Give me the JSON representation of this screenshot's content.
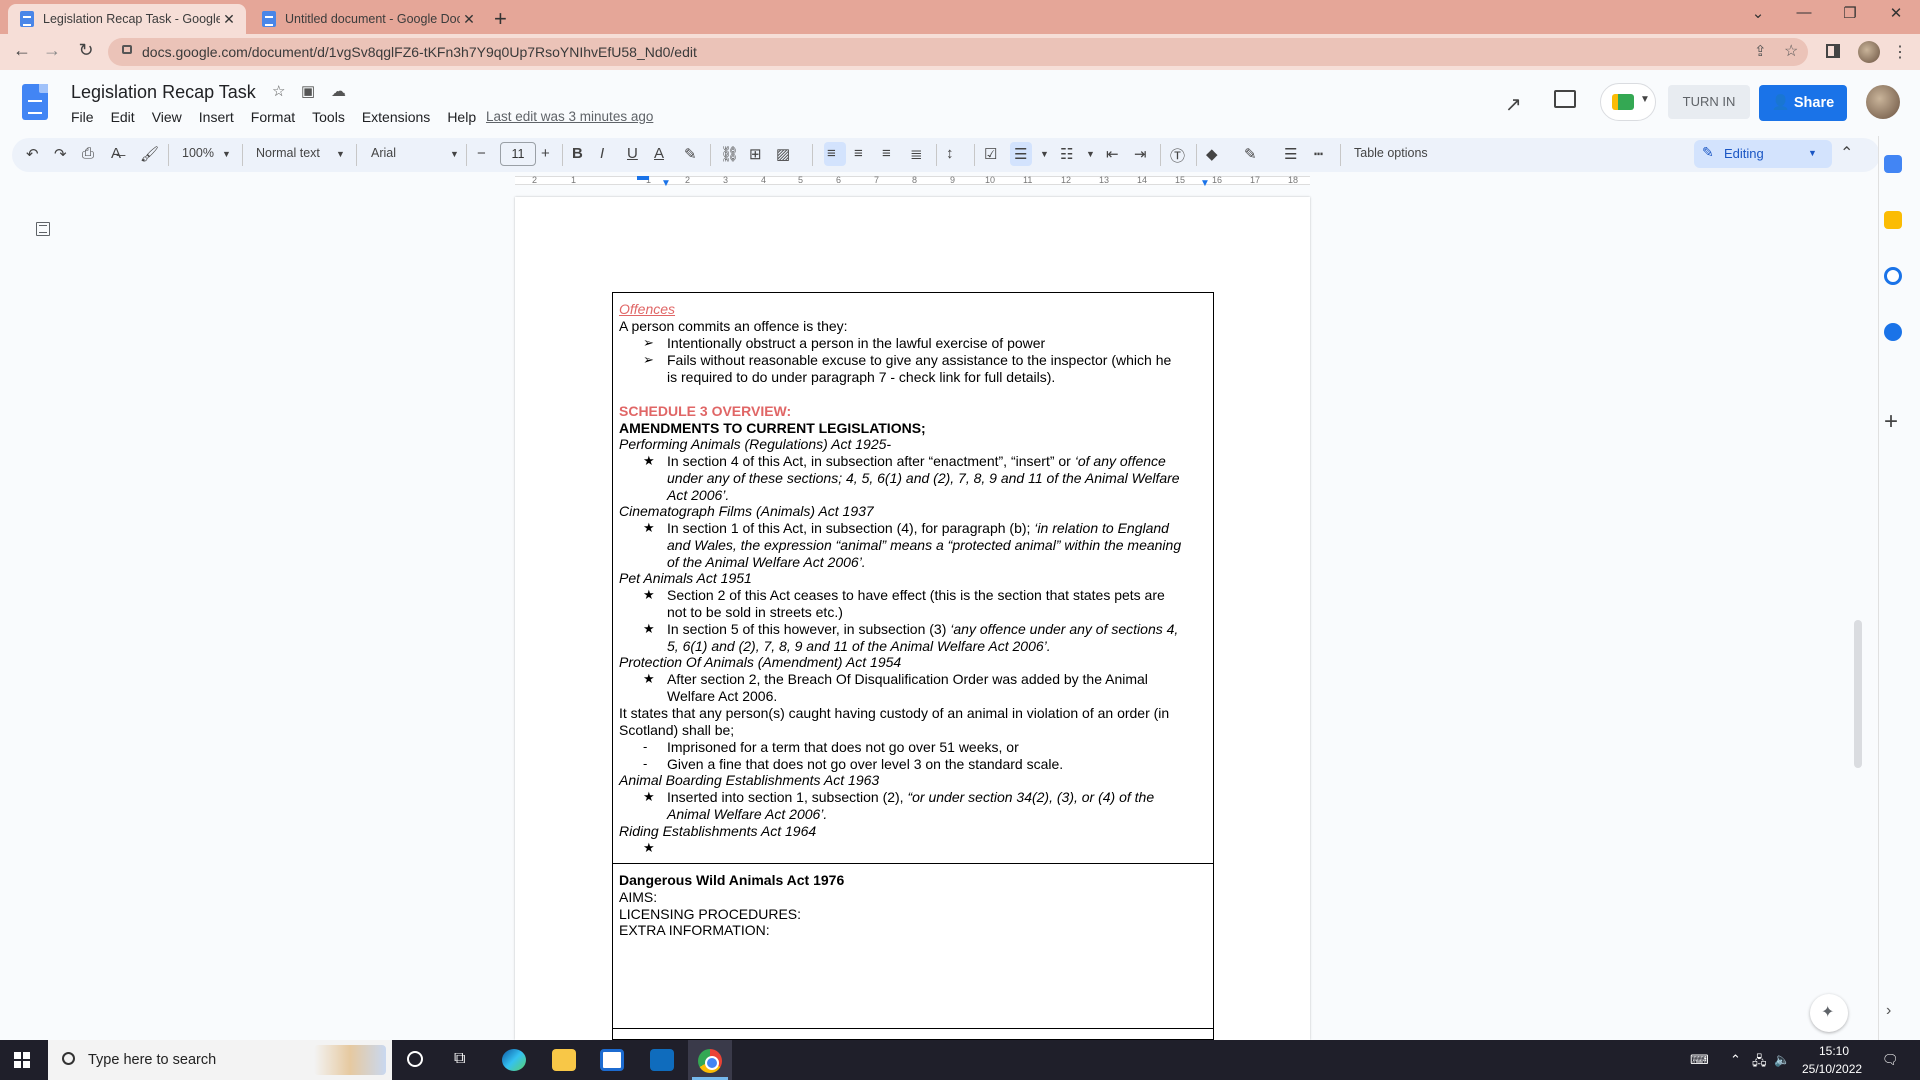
{
  "browser": {
    "tabs": [
      {
        "title": "Legislation Recap Task - Google D",
        "active": true
      },
      {
        "title": "Untitled document - Google Doc",
        "active": false
      }
    ],
    "url": "docs.google.com/document/d/1vgSv8qglFZ6-tKFn3h7Y9q0Up7RsoYNIhvEfU58_Nd0/edit"
  },
  "docs": {
    "title": "Legislation Recap Task",
    "menu": [
      "File",
      "Edit",
      "View",
      "Insert",
      "Format",
      "Tools",
      "Extensions",
      "Help"
    ],
    "last_edit": "Last edit was 3 minutes ago",
    "turn_in": "TURN IN",
    "share": "Share"
  },
  "toolbar": {
    "zoom": "100%",
    "style": "Normal text",
    "font": "Arial",
    "font_size": "11",
    "table_options": "Table options",
    "mode": "Editing"
  },
  "ruler": [
    "2",
    "1",
    "1",
    "2",
    "3",
    "4",
    "5",
    "6",
    "7",
    "8",
    "9",
    "10",
    "11",
    "12",
    "13",
    "14",
    "15",
    "16",
    "17",
    "18"
  ],
  "document": {
    "offences_heading": "Offences",
    "offences_intro": "A person commits an offence is they:",
    "offences_bullets": [
      "Intentionally obstruct a person in the lawful exercise of power",
      "Fails without reasonable excuse to give any assistance to the inspector (which he",
      "is required to do under paragraph 7 - check link for full details)."
    ],
    "schedule_heading": "SCHEDULE 3 OVERVIEW:",
    "amendments_heading": "AMENDMENTS TO CURRENT LEGISLATIONS;",
    "act1": "Performing Animals (Regulations) Act 1925-",
    "act1_b1_plain": "In section 4 of this Act, in subsection after “enactment”, “insert” or ",
    "act1_b1_it": "‘of any offence",
    "act1_b1_l2": "under any of these sections; 4, 5, 6(1) and (2), 7, 8, 9 and 11 of the Animal Welfare",
    "act1_b1_l3": "Act 2006’.",
    "act2": "Cinematograph Films (Animals) Act 1937",
    "act2_b1_plain": "In section 1 of this Act, in subsection (4), for paragraph (b); ",
    "act2_b1_it": "‘in relation to England",
    "act2_b1_l2": "and Wales, the expression “animal” means a “protected animal” within the meaning",
    "act2_b1_l3": "of the Animal Welfare Act 2006’.",
    "act3": "Pet Animals Act 1951",
    "act3_b1_l1": "Section 2 of this Act ceases to have effect (this is the section that states pets are",
    "act3_b1_l2": "not to be sold in streets etc.)",
    "act3_b2_plain": "In section 5 of this however, in subsection (3) ",
    "act3_b2_it": "‘any offence under any of sections 4,",
    "act3_b2_l2": "5, 6(1) and (2), 7, 8, 9 and 11 of the Animal Welfare Act 2006’.",
    "act4": "Protection Of Animals (Amendment) Act 1954",
    "act4_b1_l1": "After section 2, the Breach Of Disqualification Order was added by the Animal",
    "act4_b1_l2": "Welfare Act 2006.",
    "act4_p1": "It states that any person(s) caught having custody of an animal in violation of an order (in",
    "act4_p2": "Scotland) shall be;",
    "act4_d1": "Imprisoned for a term that does not go over 51 weeks, or",
    "act4_d2": "Given a fine that does not go over level 3 on the standard scale.",
    "act5": "Animal Boarding Establishments Act 1963",
    "act5_b1_plain": "Inserted into section 1, subsection (2), ",
    "act5_b1_it": "“or under section 34(2), (3), or (4) of the",
    "act5_b1_l2": "Animal Welfare Act 2006’.",
    "act6": "Riding Establishments Act 1964",
    "dwa_heading": "Dangerous Wild Animals Act 1976",
    "dwa_aims": "AIMS:",
    "dwa_licensing": "LICENSING PROCEDURES:",
    "dwa_extra": "EXTRA INFORMATION:",
    "star": "★",
    "arrow": "➢",
    "dash": "-"
  },
  "taskbar": {
    "search_placeholder": "Type here to search",
    "time": "15:10",
    "date": "25/10/2022"
  },
  "colors": {
    "tabbar": "#e5a698",
    "accent_blue": "#1a73e8",
    "heading_red": "#e06666"
  }
}
